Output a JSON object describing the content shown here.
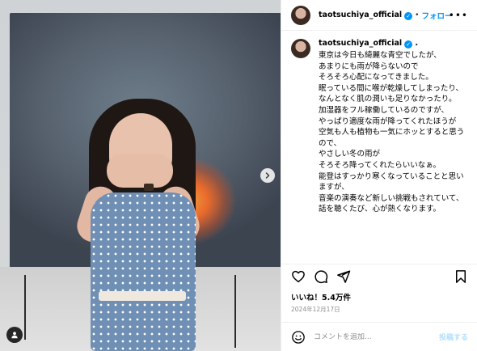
{
  "header": {
    "username": "taotsuchiya_official",
    "separator": "•",
    "follow_label": "フォロー",
    "more_label": "•••"
  },
  "caption": {
    "username": "taotsuchiya_official",
    "suffix": ".",
    "text": "東京は今日も綺麗な青空でしたが、\nあまりにも雨が降らないので\nそろそろ心配になってきました。\n眠っている間に喉が乾燥してしまったり、\nなんとなく肌の潤いも足りなかったり。\n加湿器をフル稼働しているのですが、\nやっぱり適度な雨が降ってくれたほうが\n空気も人も植物も一気にホッとすると思うので、\nやさしい冬の雨が\nそろそろ降ってくれたらいいなぁ。\n能登はすっかり寒くなっていることと思いますが、\n音楽の演奏など新しい挑戦もされていて、\n話を聴くたび、心が熱くなります。"
  },
  "engagement": {
    "likes": "いいね！5.4万件",
    "date": "2024年12月17日"
  },
  "comment": {
    "placeholder": "コメントを追加...",
    "post_label": "投稿する"
  },
  "icons": {
    "heart": "heart-icon",
    "comment": "comment-icon",
    "share": "share-icon",
    "save": "bookmark-icon",
    "emoji": "emoji-icon",
    "next": "chevron-right-icon",
    "tag": "user-tag-icon",
    "verified": "verified-badge-icon"
  },
  "colors": {
    "accent": "#0095f6",
    "muted": "#8e8e8e",
    "divider": "#efefef",
    "post_disabled": "#b2dffc"
  }
}
